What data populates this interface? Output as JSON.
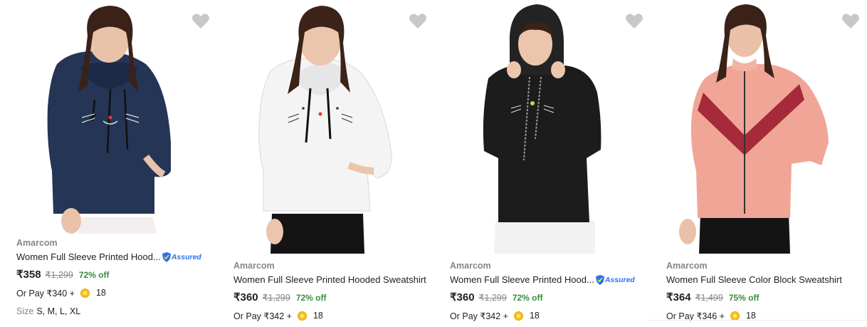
{
  "products": [
    {
      "brand": "Amarcom",
      "title": "Women Full Sleeve Printed Hood...",
      "assured": "Assured",
      "price": "₹358",
      "mrp": "₹1,299",
      "discount": "72% off",
      "or_pay": "Or Pay ₹340 +",
      "coins": "18",
      "size_label": "Size",
      "sizes": "S, M, L, XL",
      "color": "#253555"
    },
    {
      "brand": "Amarcom",
      "title": "Women Full Sleeve Printed Hooded Sweatshirt",
      "price": "₹360",
      "mrp": "₹1,299",
      "discount": "72% off",
      "or_pay": "Or Pay ₹342 +",
      "coins": "18",
      "color": "#f4f4f4"
    },
    {
      "brand": "Amarcom",
      "title": "Women Full Sleeve Printed Hood...",
      "assured": "Assured",
      "price": "₹360",
      "mrp": "₹1,299",
      "discount": "72% off",
      "or_pay": "Or Pay ₹342 +",
      "coins": "18",
      "color": "#1c1c1c"
    },
    {
      "brand": "Amarcom",
      "title": "Women Full Sleeve Color Block Sweatshirt",
      "price": "₹364",
      "mrp": "₹1,499",
      "discount": "75% off",
      "or_pay": "Or Pay ₹346 +",
      "coins": "18",
      "color": "#f1a596"
    }
  ],
  "icons": {
    "wishlist": "heart-icon",
    "coin": "supercoin-icon",
    "assured": "assured-shield-icon"
  },
  "colors": {
    "discount": "#388e3c",
    "assured": "#2874f0",
    "muted": "#878787"
  }
}
